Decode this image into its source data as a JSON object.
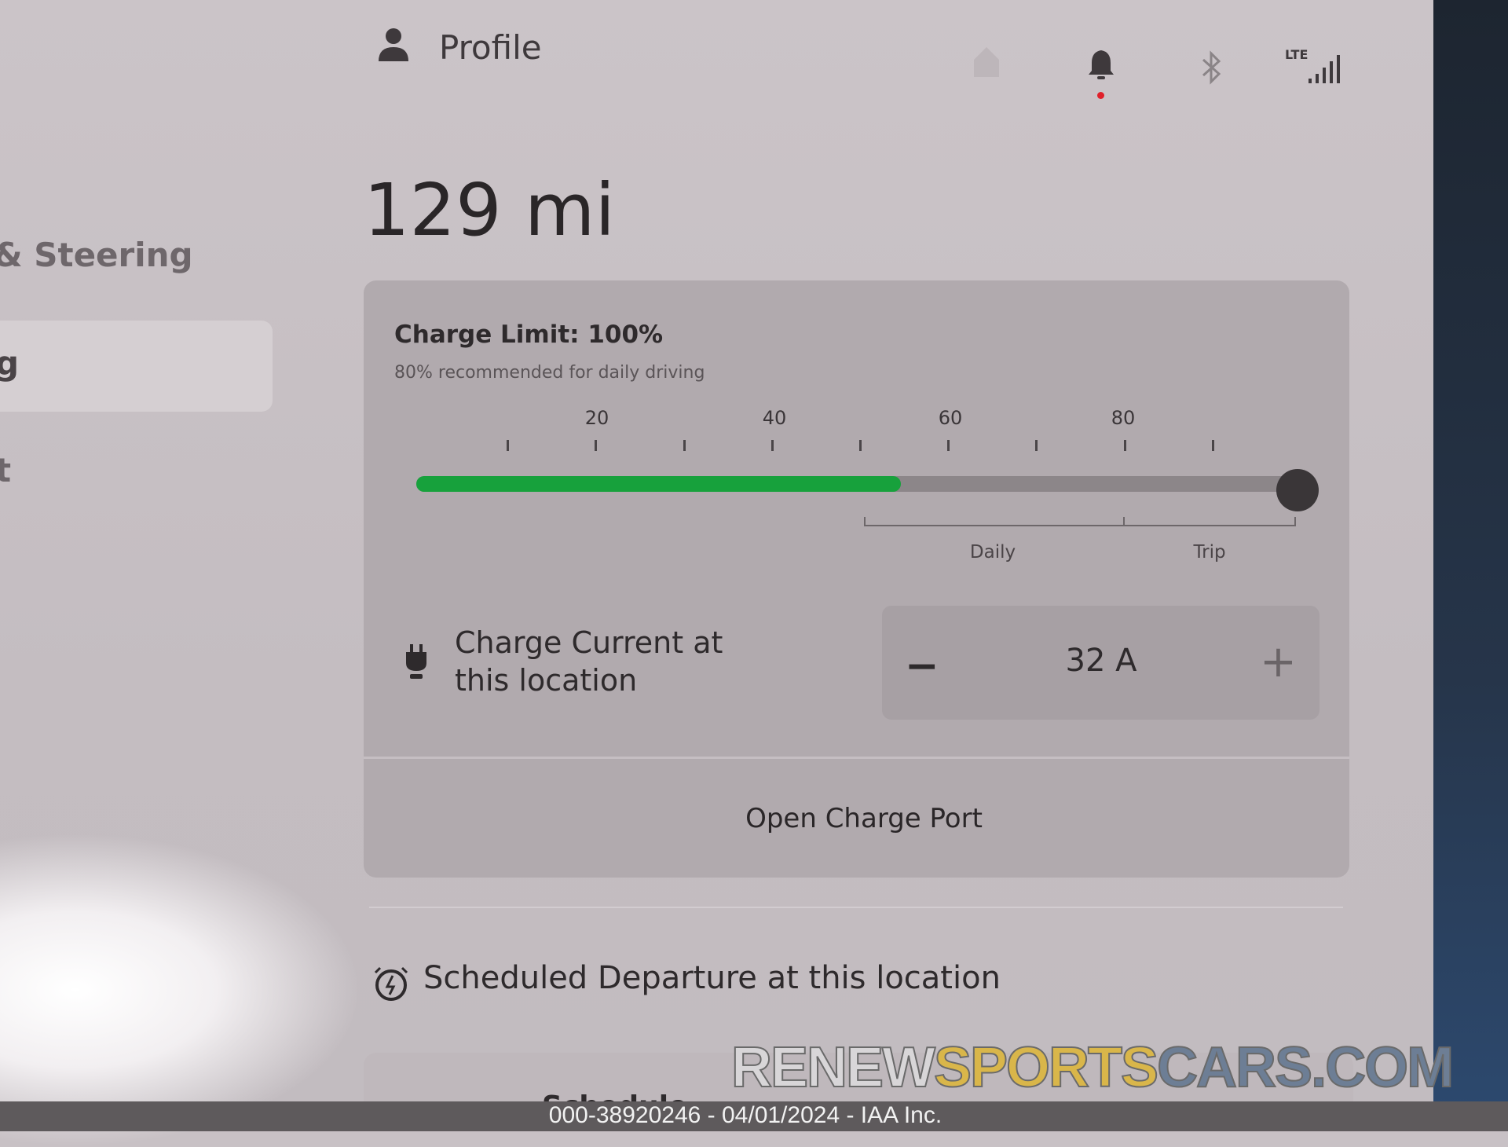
{
  "header": {
    "profile_label": "Profile",
    "icons": [
      "person-icon",
      "home-icon",
      "bell-icon",
      "bluetooth-icon",
      "lte-signal-icon"
    ],
    "lte_label": "LTE",
    "notification_dot_color": "#e0202a"
  },
  "sidebar": {
    "items": [
      {
        "label": "& Steering"
      },
      {
        "label": "g"
      },
      {
        "label": "t"
      }
    ]
  },
  "range": {
    "value": "129 mi"
  },
  "charge": {
    "title": "Charge Limit: 100%",
    "subtitle": "80% recommended for daily driving",
    "limit_percent": 100,
    "current_level_percent": 55,
    "tick_labels": [
      "20",
      "40",
      "60",
      "80"
    ],
    "ranges": {
      "daily": "Daily",
      "trip": "Trip"
    },
    "accent_color": "#17a13c"
  },
  "current": {
    "label_line1": "Charge Current at",
    "label_line2": "this location",
    "value": "32 A",
    "minus": "−",
    "plus": "+"
  },
  "open_port": {
    "label": "Open Charge Port"
  },
  "departure": {
    "label": "Scheduled Departure at this location"
  },
  "next_section": {
    "label": "Schedule"
  },
  "watermark": {
    "part1": "RENEW",
    "part2": "SPORTS",
    "part3": "CARS.COM"
  },
  "footer": {
    "caption": "000-38920246 - 04/01/2024 - IAA Inc."
  }
}
